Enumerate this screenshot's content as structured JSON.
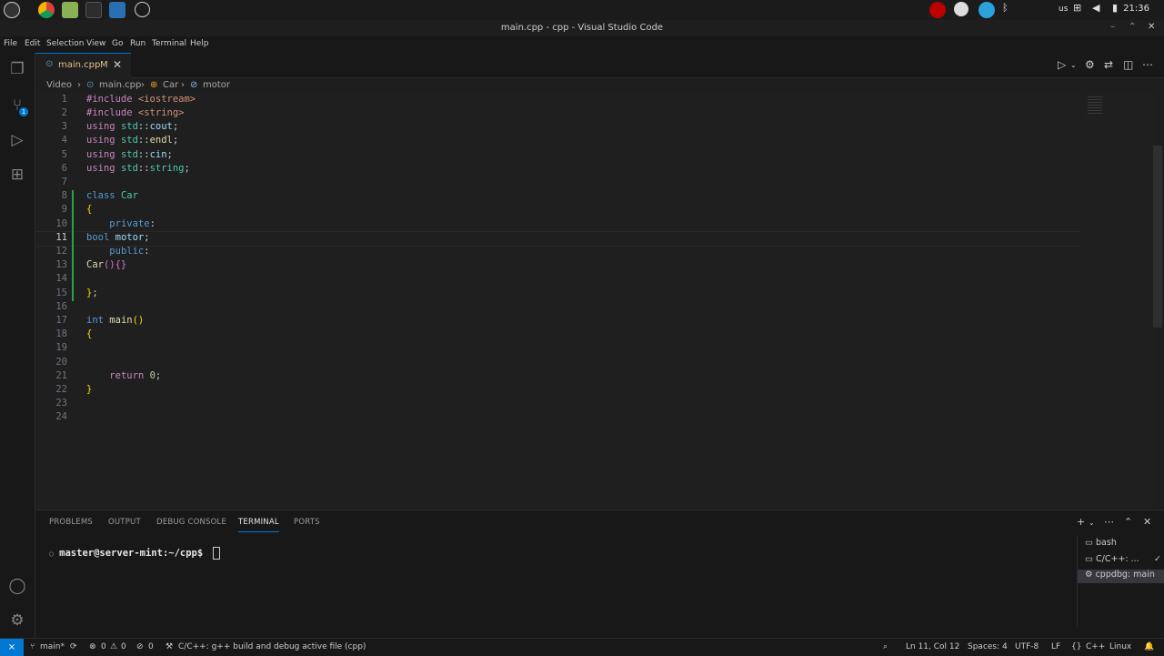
{
  "system": {
    "clock": "21:36",
    "keyboard_layout": "us"
  },
  "window": {
    "title": "main.cpp - cpp - Visual Studio Code"
  },
  "menu": [
    "File",
    "Edit",
    "Selection",
    "View",
    "Go",
    "Run",
    "Terminal",
    "Help"
  ],
  "activity": {
    "scm_badge": "1"
  },
  "tab": {
    "label": "main.cpp",
    "modified": "M"
  },
  "breadcrumb": [
    "Video",
    "main.cpp",
    "Car",
    "motor"
  ],
  "editor": {
    "line_numbers": [
      "1",
      "2",
      "3",
      "4",
      "5",
      "6",
      "7",
      "8",
      "9",
      "10",
      "11",
      "12",
      "13",
      "14",
      "15",
      "16",
      "17",
      "18",
      "19",
      "20",
      "21",
      "22",
      "23",
      "24"
    ],
    "current_line": "11"
  },
  "panel": {
    "tabs": [
      "PROBLEMS",
      "OUTPUT",
      "DEBUG CONSOLE",
      "TERMINAL",
      "PORTS"
    ],
    "active_tab": "TERMINAL",
    "prompt": "master@server-mint:~/cpp$",
    "terminals": [
      "bash",
      "C/C++: ...",
      "cppdbg: main"
    ]
  },
  "status": {
    "branch": "main*",
    "errors": "0",
    "warnings": "0",
    "ports": "0",
    "task": "C/C++: g++ build and debug active file (cpp)",
    "position": "Ln 11, Col 12",
    "spaces": "Spaces: 4",
    "encoding": "UTF-8",
    "eol": "LF",
    "language": "C++",
    "platform": "Linux"
  },
  "colors": {
    "accent": "#0078d4",
    "git_added": "#2ea043",
    "modified_tab": "#e2c08d"
  }
}
